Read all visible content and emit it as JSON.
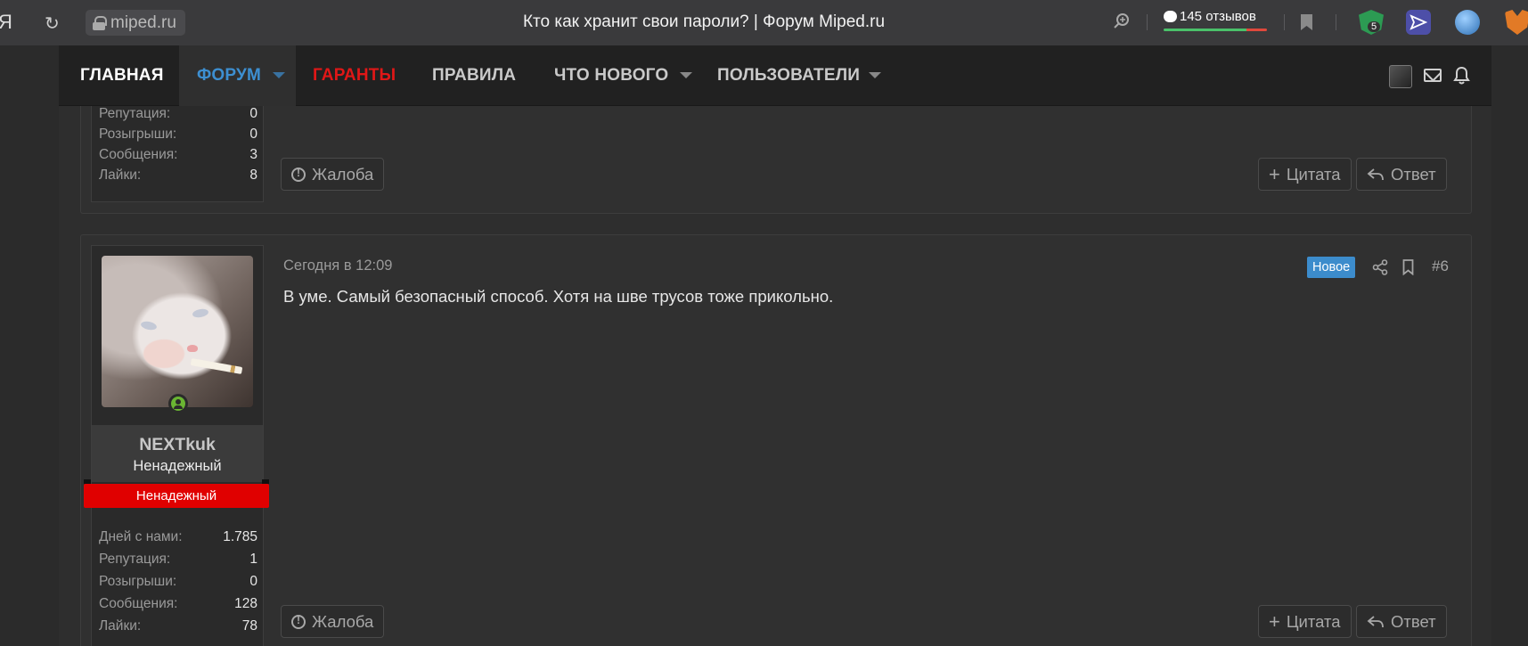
{
  "browser": {
    "yandex_glyph": "Я",
    "url": "miped.ru",
    "title": "Кто как хранит свои пароли? | Форум Miped.ru",
    "reviews": "145 отзывов",
    "ext_badge": "5"
  },
  "nav": {
    "home": "ГЛАВНАЯ",
    "forum": "ФОРУМ",
    "guarantors": "ГАРАНТЫ",
    "rules": "ПРАВИЛА",
    "whats_new": "ЧТО НОВОГО",
    "users": "ПОЛЬЗОВАТЕЛИ"
  },
  "post_prev": {
    "stats": [
      {
        "label": "Репутация:",
        "value": "0"
      },
      {
        "label": "Розыгрыши:",
        "value": "0"
      },
      {
        "label": "Сообщения:",
        "value": "3"
      },
      {
        "label": "Лайки:",
        "value": "8"
      }
    ],
    "report": "Жалоба",
    "quote": "Цитата",
    "reply": "Ответ"
  },
  "post": {
    "date": "Сегодня в 12:09",
    "badge_new": "Новое",
    "number": "#6",
    "body": "В уме. Самый безопасный способ. Хотя на шве трусов тоже прикольно.",
    "user": {
      "name": "NEXTkuk",
      "title": "Ненадежный",
      "banner": "Ненадежный",
      "stats": [
        {
          "label": "Дней с нами:",
          "value": "1.785"
        },
        {
          "label": "Репутация:",
          "value": "1"
        },
        {
          "label": "Розыгрыши:",
          "value": "0"
        },
        {
          "label": "Сообщения:",
          "value": "128"
        },
        {
          "label": "Лайки:",
          "value": "78"
        }
      ]
    },
    "report": "Жалоба",
    "quote": "Цитата",
    "reply": "Ответ"
  },
  "colors": {
    "forum_active": "#3d8fd1",
    "guarantors": "#e01717",
    "banner_red": "#e00000",
    "badge_new": "#3c8ccc",
    "online": "#6ab532"
  }
}
